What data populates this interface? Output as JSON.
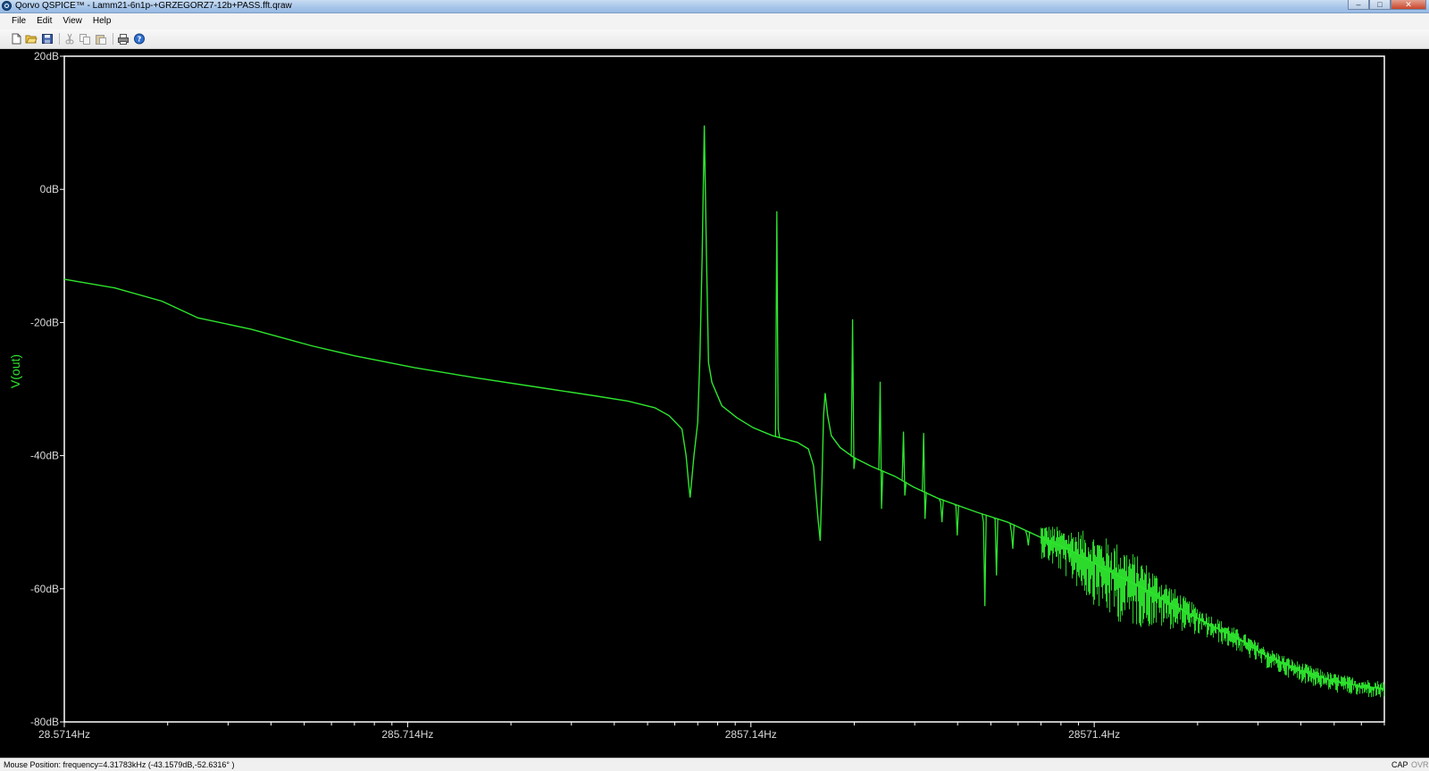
{
  "window": {
    "title": "Qorvo QSPICE™ - Lamm21-6n1p-+GRZEGORZ7-12b+PASS.fft.qraw",
    "controls": {
      "minimize": "–",
      "maximize": "□",
      "close": "✕"
    }
  },
  "menu": {
    "items": [
      {
        "id": "file",
        "label": "File"
      },
      {
        "id": "edit",
        "label": "Edit"
      },
      {
        "id": "view",
        "label": "View"
      },
      {
        "id": "help",
        "label": "Help"
      }
    ]
  },
  "toolbar": {
    "buttons": [
      "new-file-icon",
      "open-folder-icon",
      "save-icon",
      "cut-icon",
      "copy-icon",
      "paste-icon",
      "print-icon",
      "help-icon"
    ]
  },
  "colors": {
    "trace": "#2ee62e",
    "plot_background": "#000000",
    "plot_frame": "#ffffff",
    "axis_text": "#d8d8d8"
  },
  "chart_data": {
    "type": "line",
    "trace_label": "V(out)",
    "xscale": "log",
    "xlim_hz": [
      28.5714,
      200000
    ],
    "ylim_db": [
      -80,
      20
    ],
    "y_ticks": [
      {
        "value": 20,
        "label": "20dB"
      },
      {
        "value": 0,
        "label": "0dB"
      },
      {
        "value": -20,
        "label": "-20dB"
      },
      {
        "value": -40,
        "label": "-40dB"
      },
      {
        "value": -60,
        "label": "-60dB"
      },
      {
        "value": -80,
        "label": "-80dB"
      }
    ],
    "x_ticks": [
      {
        "value": 28.5714,
        "label": "28.5714Hz"
      },
      {
        "value": 285.714,
        "label": "285.714Hz"
      },
      {
        "value": 2857.14,
        "label": "2857.14Hz"
      },
      {
        "value": 28571.4,
        "label": "28571.4Hz"
      }
    ],
    "baseline": [
      [
        28.5714,
        -13.5
      ],
      [
        40,
        -14.8
      ],
      [
        55,
        -16.8
      ],
      [
        70,
        -19.3
      ],
      [
        100,
        -21.0
      ],
      [
        150,
        -23.5
      ],
      [
        200,
        -25.0
      ],
      [
        300,
        -26.8
      ],
      [
        450,
        -28.3
      ],
      [
        700,
        -29.8
      ],
      [
        1000,
        -31.0
      ],
      [
        1250,
        -31.8
      ],
      [
        1500,
        -32.8
      ],
      [
        1650,
        -34.0
      ],
      [
        1800,
        -36.0
      ],
      [
        1850,
        -40.0
      ],
      [
        1880,
        -44.0
      ],
      [
        1900,
        -46.3
      ],
      [
        1950,
        -40.0
      ],
      [
        2000,
        -35.0
      ],
      [
        2030,
        -25.0
      ],
      [
        2060,
        -10.0
      ],
      [
        2090,
        9.6
      ],
      [
        2120,
        -10.0
      ],
      [
        2150,
        -26.0
      ],
      [
        2200,
        -29.0
      ],
      [
        2350,
        -32.5
      ],
      [
        2600,
        -34.3
      ],
      [
        2900,
        -35.8
      ],
      [
        3300,
        -37.0
      ],
      [
        3900,
        -38.0
      ],
      [
        4200,
        -39.0
      ],
      [
        4350,
        -41.5
      ],
      [
        4480,
        -49.5
      ],
      [
        4550,
        -52.8
      ],
      [
        4600,
        -44.0
      ],
      [
        4650,
        -34.0
      ],
      [
        4700,
        -30.6
      ],
      [
        4780,
        -34.0
      ],
      [
        4900,
        -37.0
      ],
      [
        5200,
        -38.8
      ],
      [
        5700,
        -40.3
      ],
      [
        6400,
        -41.6
      ],
      [
        7500,
        -43.1
      ],
      [
        8500,
        -44.7
      ],
      [
        10000,
        -46.4
      ],
      [
        13000,
        -48.5
      ],
      [
        16000,
        -50.0
      ],
      [
        20000,
        -52.3
      ],
      [
        25000,
        -54.5
      ],
      [
        30000,
        -56.8
      ],
      [
        40000,
        -60.0
      ],
      [
        50000,
        -62.8
      ],
      [
        60000,
        -65.0
      ],
      [
        75000,
        -67.5
      ],
      [
        90000,
        -70.0
      ],
      [
        110000,
        -72.0
      ],
      [
        140000,
        -73.8
      ],
      [
        170000,
        -74.6
      ],
      [
        200000,
        -75.0
      ]
    ],
    "spikes": [
      {
        "f": 3400,
        "top": -3.3,
        "bottom": -36.0
      },
      {
        "f": 5650,
        "top": -19.5,
        "bottom": -42.0
      },
      {
        "f": 6800,
        "top": -28.9,
        "bottom": -48.0
      },
      {
        "f": 7950,
        "top": -36.4,
        "bottom": -46.0
      },
      {
        "f": 9100,
        "top": -36.6,
        "bottom": -49.5
      },
      {
        "f": 10200,
        "top": -47.0,
        "bottom": -50.0
      },
      {
        "f": 11300,
        "top": -47.5,
        "bottom": -52.0
      },
      {
        "f": 13600,
        "top": -50.0,
        "bottom": -62.6
      },
      {
        "f": 14700,
        "top": -49.5,
        "bottom": -58.0
      },
      {
        "f": 16400,
        "top": -51.5,
        "bottom": -54.0
      },
      {
        "f": 18200,
        "top": -52.0,
        "bottom": -53.5
      },
      {
        "f": 21000,
        "top": -53.0,
        "bottom": -55.0
      },
      {
        "f": 24000,
        "top": -54.0,
        "bottom": -56.0
      }
    ],
    "noise_band": {
      "f_start": 20000,
      "f_end": 200000,
      "peak_amplitude_db": 4.5
    }
  },
  "status": {
    "mouse_position": "Mouse Position: frequency=4.31783kHz   (-43.1579dB,-52.6316° )",
    "cap": "CAP",
    "ovr": "OVR"
  }
}
